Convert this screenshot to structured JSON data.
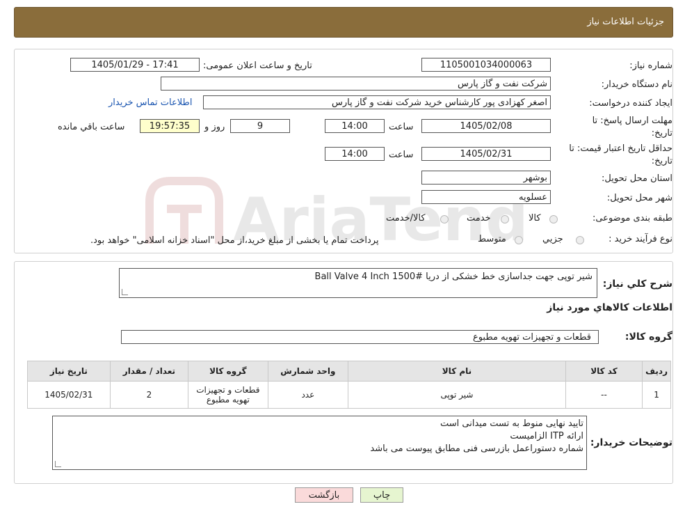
{
  "header": {
    "title": "جزئیات اطلاعات نیاز"
  },
  "form": {
    "need_number_label": "شماره نیاز:",
    "need_number": "1105001034000063",
    "announce_label": "تاریخ و ساعت اعلان عمومی:",
    "announce_value": "1405/01/29 - 17:41",
    "buyer_org_label": "نام دستگاه خریدار:",
    "buyer_org": "شرکت نفت و گاز پارس",
    "requester_label": "ایجاد کننده درخواست:",
    "requester": "اصغر کهزادی پور کارشناس خرید شرکت نفت و گاز پارس",
    "contact_link": "اطلاعات تماس خریدار",
    "deadline_label_1": "مهلت ارسال پاسخ: تا",
    "deadline_label_2": "تاریخ:",
    "deadline_date": "1405/02/08",
    "hour_label": "ساعت",
    "deadline_time": "14:00",
    "days_value": "9",
    "days_label": "روز و",
    "remaining_time": "19:57:35",
    "remaining_label": "ساعت باقي مانده",
    "price_valid_label_1": "حداقل تاریخ اعتبار قیمت: تا",
    "price_valid_label_2": "تاریخ:",
    "price_valid_date": "1405/02/31",
    "price_valid_hour_label": "ساعت",
    "price_valid_time": "14:00",
    "province_label": "استان محل تحویل:",
    "province": "بوشهر",
    "city_label": "شهر محل تحویل:",
    "city": "عسلویه",
    "category_label": "طبقه بندی موضوعی:",
    "category_options": [
      "کالا",
      "خدمت",
      "کالا/خدمت"
    ],
    "process_label": "نوع فرآیند خرید :",
    "process_options": [
      "جزیي",
      "متوسط"
    ],
    "process_note": "پرداخت تمام یا بخشی از مبلغ خرید،از محل \"اسناد خزانه اسلامی\" خواهد بود."
  },
  "details": {
    "desc_label": "شرح کلي نياز:",
    "desc_value": "شیر توپی جهت جداسازی خط خشکی از دریا Ball Valve 4 Inch 1500#",
    "goods_info_title": "اطلاعات کالاهاي مورد نياز",
    "goods_group_label": "گروه کالا:",
    "goods_group": "قطعات و تجهیزات تهویه مطبوع",
    "table": {
      "headers": [
        "رديف",
        "کد کالا",
        "نام کالا",
        "واحد شمارش",
        "گروه کالا",
        "تعداد / مقدار",
        "تاريخ نياز"
      ],
      "rows": [
        [
          "1",
          "--",
          "شیر توپی",
          "عدد",
          "قطعات و تجهیزات تهویه مطبوع",
          "2",
          "1405/02/31"
        ]
      ]
    },
    "buyer_notes_label": "توضیحات خریدار:",
    "buyer_notes": [
      "تایید نهایی منوط به تست میدانی است",
      "ارائه ITP الزامیست",
      "شماره دستوراعمل بازرسی فنی مطابق پیوست می باشد"
    ]
  },
  "buttons": {
    "print": "چاپ",
    "back": "بازگشت"
  },
  "watermark": {
    "text": "AriaTender.neT"
  },
  "colors": {
    "header_bg": "#8a6d3b",
    "timer_bg": "#ffffcc",
    "print_btn": "#e6f5d0",
    "back_btn": "#fadada",
    "link": "#1a55b0"
  }
}
